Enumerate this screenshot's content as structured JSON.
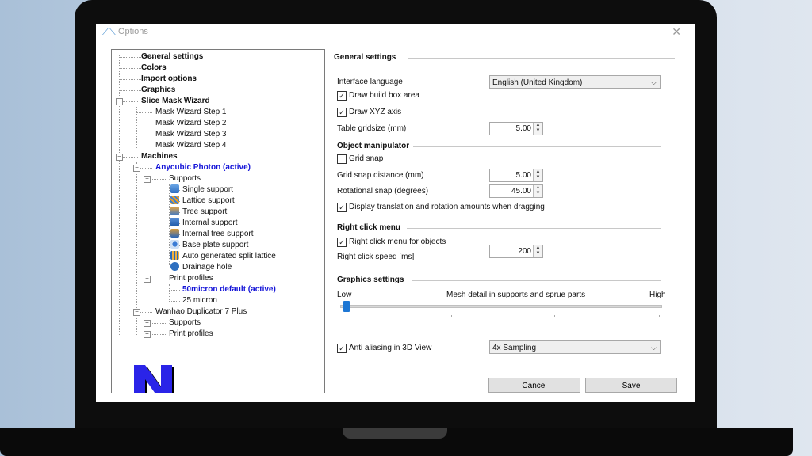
{
  "window": {
    "title": "Options"
  },
  "tree": {
    "general_settings": "General settings",
    "colors": "Colors",
    "import_options": "Import options",
    "graphics": "Graphics",
    "slice_mask_wizard": "Slice Mask Wizard",
    "mask_steps": [
      "Mask Wizard Step 1",
      "Mask Wizard Step 2",
      "Mask Wizard Step 3",
      "Mask Wizard Step 4"
    ],
    "machines": "Machines",
    "anycubic": "Anycubic Photon (active)",
    "supports": "Supports",
    "support_items": [
      "Single support",
      "Lattice support",
      "Tree support",
      "Internal support",
      "Internal tree support",
      "Base plate support",
      "Auto generated split lattice",
      "Drainage hole"
    ],
    "print_profiles": "Print profiles",
    "profile_active": "50micron default (active)",
    "profile_25": "25 micron",
    "wanhao": "Wanhao Duplicator 7 Plus",
    "wanhao_supports": "Supports",
    "wanhao_print_profiles": "Print profiles"
  },
  "general": {
    "title": "General settings",
    "interface_language_label": "Interface language",
    "interface_language_value": "English (United Kingdom)",
    "draw_build_box": "Draw build box area",
    "draw_xyz": "Draw XYZ axis",
    "table_gridsize_label": "Table gridsize (mm)",
    "table_gridsize_value": "5.00"
  },
  "object_manipulator": {
    "title": "Object manipulator",
    "grid_snap": "Grid snap",
    "grid_snap_distance_label": "Grid snap distance (mm)",
    "grid_snap_distance_value": "5.00",
    "rotational_snap_label": "Rotational snap (degrees)",
    "rotational_snap_value": "45.00",
    "display_amounts": "Display translation and rotation amounts when dragging"
  },
  "right_click": {
    "title": "Right click menu",
    "menu_for_objects": "Right click menu for objects",
    "speed_label": "Right click speed [ms]",
    "speed_value": "200"
  },
  "graphics_settings": {
    "title": "Graphics settings",
    "low": "Low",
    "mesh_detail": "Mesh detail in supports and sprue parts",
    "high": "High",
    "mesh_detail_level": 0,
    "anti_aliasing": "Anti aliasing in 3D View",
    "sampling_value": "4x Sampling"
  },
  "buttons": {
    "cancel": "Cancel",
    "save": "Save"
  },
  "icons": {
    "check": "✓",
    "close": "✕",
    "dropdown": "⌵"
  },
  "colors": {
    "active_item": "#1515d8",
    "slider_thumb": "#1e77d4",
    "logo_blue": "#2a24e8"
  }
}
